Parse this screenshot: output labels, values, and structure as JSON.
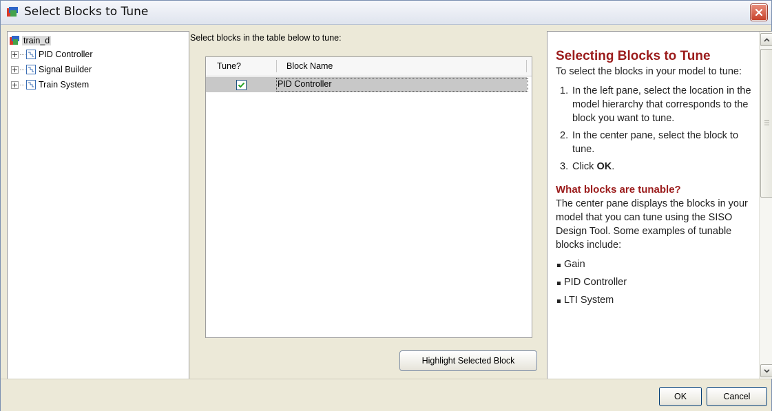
{
  "window": {
    "title": "Select Blocks to Tune"
  },
  "tree": {
    "root": "train_d",
    "items": [
      {
        "label": "PID Controller"
      },
      {
        "label": "Signal Builder"
      },
      {
        "label": "Train System"
      }
    ]
  },
  "center": {
    "instruction": "Select blocks in the table below to tune:",
    "columns": [
      "Tune?",
      "Block Name"
    ],
    "rows": [
      {
        "tune": true,
        "block_name": "PID Controller"
      }
    ],
    "highlight_button": "Highlight Selected Block"
  },
  "help": {
    "title": "Selecting Blocks to Tune",
    "intro": "To select the blocks in your model to tune:",
    "steps": [
      {
        "num": "1.",
        "text": "In the left pane, select the location in the model hierarchy that corresponds to the block you want to tune."
      },
      {
        "num": "2.",
        "text": "In the center pane, select the block to tune."
      },
      {
        "num": "3.",
        "text_prefix": "Click ",
        "bold": "OK",
        "text_suffix": "."
      }
    ],
    "section2_title": "What blocks are tunable?",
    "section2_body": "The center pane displays the blocks in your model that you can tune using the SISO Design Tool. Some examples of tunable blocks include:",
    "examples": [
      "Gain",
      "PID Controller",
      "LTI System"
    ]
  },
  "buttons": {
    "ok": "OK",
    "cancel": "Cancel"
  },
  "icons": {
    "title": "simulink-model-icon",
    "close": "close-icon",
    "block": "subsystem-block-icon"
  }
}
